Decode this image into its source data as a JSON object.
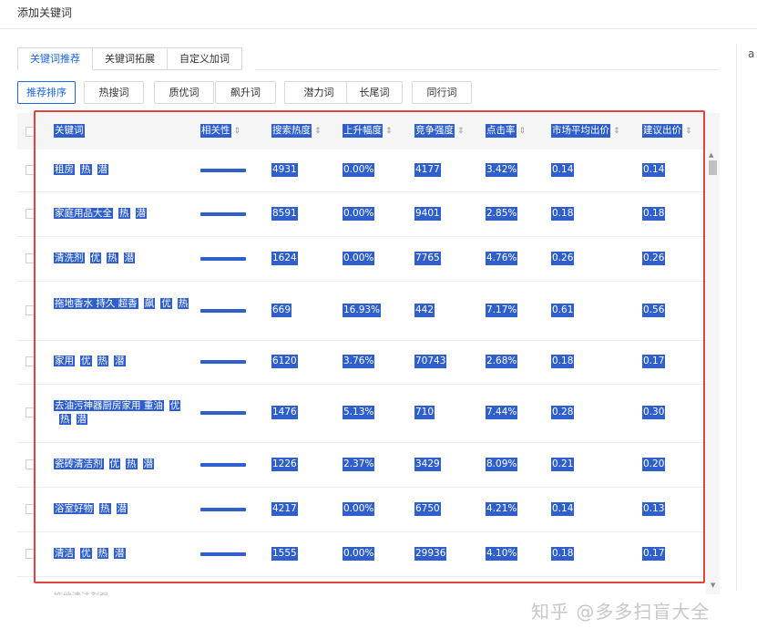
{
  "header": {
    "title": "添加关键词"
  },
  "right_edge_text": "a",
  "tabs": [
    {
      "label": "关键词推荐",
      "active": true
    },
    {
      "label": "关键词拓展",
      "active": false
    },
    {
      "label": "自定义加词",
      "active": false
    }
  ],
  "filters": [
    {
      "label": "推荐排序",
      "active": true
    },
    {
      "label": "热搜词",
      "active": false
    },
    {
      "label": "质优词",
      "active": false
    },
    {
      "label": "飙升词",
      "active": false
    },
    {
      "label": "潜力词",
      "active": false
    },
    {
      "label": "长尾词",
      "active": false
    },
    {
      "label": "同行词",
      "active": false
    }
  ],
  "table": {
    "headers": {
      "keyword": "关键词",
      "relevance": "相关性",
      "search_heat": "搜索热度",
      "rise": "上升幅度",
      "competition": "竞争强度",
      "ctr": "点击率",
      "avg_bid": "市场平均出价",
      "suggested_bid": "建议出价"
    },
    "rows": [
      {
        "keyword": "租房",
        "tags": [
          "热",
          "潜"
        ],
        "search_heat": "4931",
        "rise": "0.00%",
        "competition": "4177",
        "ctr": "3.42%",
        "avg_bid": "0.14",
        "suggested_bid": "0.14"
      },
      {
        "keyword": "家庭用品大全",
        "tags": [
          "热",
          "潜"
        ],
        "search_heat": "8591",
        "rise": "0.00%",
        "competition": "9401",
        "ctr": "2.85%",
        "avg_bid": "0.18",
        "suggested_bid": "0.18"
      },
      {
        "keyword": "清洗剂",
        "tags": [
          "优",
          "热",
          "潜"
        ],
        "search_heat": "1624",
        "rise": "0.00%",
        "competition": "7765",
        "ctr": "4.76%",
        "avg_bid": "0.26",
        "suggested_bid": "0.26"
      },
      {
        "keyword": "拖地香水 持久 超香",
        "tags": [
          "飙",
          "优",
          "热"
        ],
        "search_heat": "669",
        "rise": "16.93%",
        "competition": "442",
        "ctr": "7.17%",
        "avg_bid": "0.61",
        "suggested_bid": "0.56"
      },
      {
        "keyword": "家用",
        "tags": [
          "优",
          "热",
          "潜"
        ],
        "search_heat": "6120",
        "rise": "3.76%",
        "competition": "70743",
        "ctr": "2.68%",
        "avg_bid": "0.18",
        "suggested_bid": "0.17"
      },
      {
        "keyword": "去油污神器厨房家用 重油",
        "tags": [
          "优",
          "热",
          "潜"
        ],
        "search_heat": "1476",
        "rise": "5.13%",
        "competition": "710",
        "ctr": "7.44%",
        "avg_bid": "0.28",
        "suggested_bid": "0.30"
      },
      {
        "keyword": "瓷砖清洁剂",
        "tags": [
          "优",
          "热",
          "潜"
        ],
        "search_heat": "1226",
        "rise": "2.37%",
        "competition": "3429",
        "ctr": "8.09%",
        "avg_bid": "0.21",
        "suggested_bid": "0.20"
      },
      {
        "keyword": "浴室好物",
        "tags": [
          "热",
          "潜"
        ],
        "search_heat": "4217",
        "rise": "0.00%",
        "competition": "6750",
        "ctr": "4.21%",
        "avg_bid": "0.14",
        "suggested_bid": "0.13"
      },
      {
        "keyword": "清洁",
        "tags": [
          "优",
          "热",
          "潜"
        ],
        "search_heat": "1555",
        "rise": "0.00%",
        "competition": "29936",
        "ctr": "4.10%",
        "avg_bid": "0.18",
        "suggested_bid": "0.17"
      }
    ]
  },
  "faded_row": "拖地清洁剂强",
  "watermark": "知乎 @多多扫盲大全",
  "colors": {
    "accent": "#1a66e6",
    "selection": "#2f5fcc",
    "highlight_frame": "#e0443a"
  }
}
